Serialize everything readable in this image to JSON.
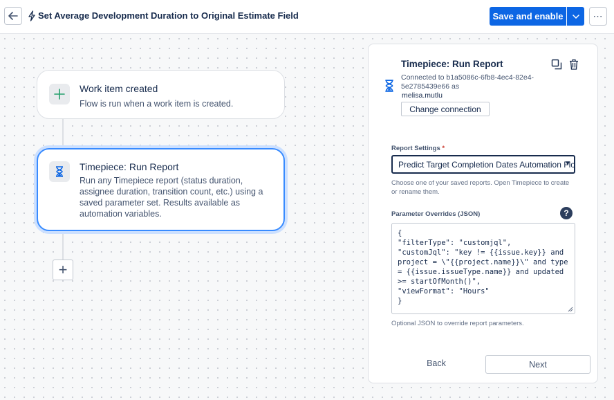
{
  "header": {
    "back_icon": "arrow-left-icon",
    "bolt_icon": "lightning-bolt-icon",
    "title": "Set Average Development Duration to Original Estimate Field",
    "save_label": "Save and enable",
    "more_label": "⋯",
    "accent": "#0c66e4"
  },
  "flow": {
    "trigger": {
      "icon": "plus-icon",
      "title": "Work item created",
      "description": "Flow is run when a work item is created."
    },
    "action": {
      "icon": "hourglass-icon",
      "title": "Timepiece: Run Report",
      "description": "Run any Timepiece report (status duration, assignee duration, transition count, etc.) using a saved parameter set. Results available as automation variables."
    },
    "add_label": "+"
  },
  "panel": {
    "title": "Timepiece: Run Report",
    "connection_text": "Connected to b1a5086c-6fb8-4ec4-82e4-5e2785439e66 as",
    "connection_user": "melisa.mutlu",
    "change_connection_label": "Change connection",
    "report_settings_label": "Report Settings",
    "required_mark": "*",
    "report_settings_value": "Predict Target Completion Dates Automation Flow",
    "report_settings_help": "Choose one of your saved reports. Open Timepiece to create or rename them.",
    "param_overrides_label": "Parameter Overrides (JSON)",
    "help_icon_label": "?",
    "json_value": "{\n\"filterType\": \"customjql\",\n\"customJql\": \"key != {{issue.key}} and project = \\\"{{project.name}}\\\" and type = {{issue.issueType.name}} and updated >= startOfMonth()\",\n\"viewFormat\": \"Hours\"\n}",
    "json_help": "Optional JSON to override report parameters.",
    "back_label": "Back",
    "next_label": "Next"
  }
}
